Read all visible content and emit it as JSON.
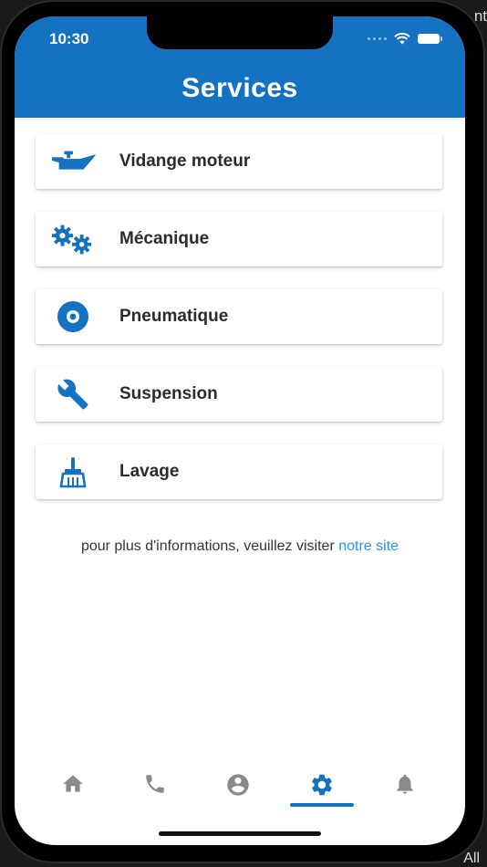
{
  "status_bar": {
    "time": "10:30"
  },
  "header": {
    "title": "Services"
  },
  "services": [
    {
      "label": "Vidange moteur",
      "icon": "oil-can-icon"
    },
    {
      "label": "Mécanique",
      "icon": "gears-icon"
    },
    {
      "label": "Pneumatique",
      "icon": "tire-icon"
    },
    {
      "label": "Suspension",
      "icon": "wrench-icon"
    },
    {
      "label": "Lavage",
      "icon": "broom-icon"
    }
  ],
  "info": {
    "text": "pour plus d'informations, veuillez visiter",
    "link": "notre site"
  },
  "bottom_nav": {
    "items": [
      {
        "icon": "home-icon",
        "active": false
      },
      {
        "icon": "phone-icon",
        "active": false
      },
      {
        "icon": "user-icon",
        "active": false
      },
      {
        "icon": "gear-icon",
        "active": true
      },
      {
        "icon": "bell-icon",
        "active": false
      }
    ]
  },
  "background": {
    "top_right_fragment": "nt",
    "bottom_right_fragment": "All"
  },
  "colors": {
    "primary": "#1572c1",
    "link": "#2196f3",
    "nav_inactive": "#8a8a8a"
  }
}
